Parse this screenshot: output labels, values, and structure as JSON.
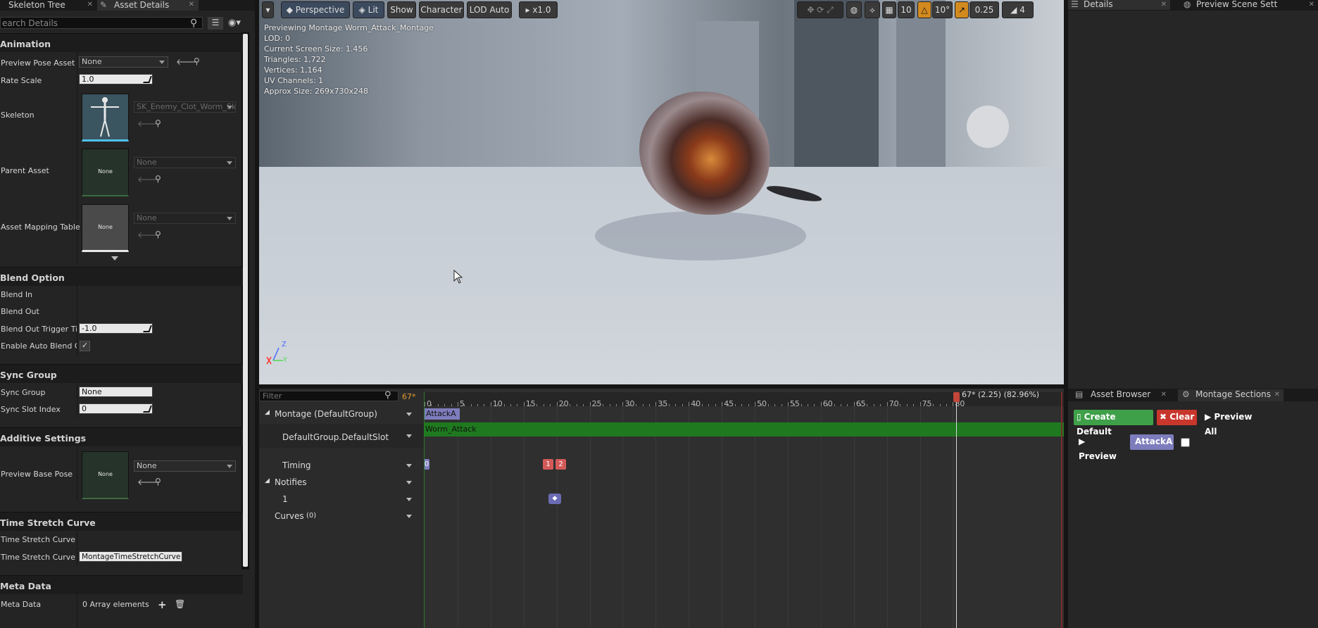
{
  "left_panel": {
    "tabs": [
      {
        "label": "Skeleton Tree"
      },
      {
        "label": "Asset Details"
      }
    ],
    "search_placeholder": "earch Details",
    "animation": {
      "title": "Animation",
      "preview_pose_label": "Preview Pose Asset",
      "preview_pose_value": "None",
      "rate_scale_label": "Rate Scale",
      "rate_scale_value": "1.0",
      "skeleton_label": "Skeleton",
      "skeleton_value": "SK_Enemy_Clot_Worm_Sk",
      "parent_asset_label": "Parent Asset",
      "parent_asset_value": "None",
      "parent_thumb_text": "None",
      "mapping_label": "Asset Mapping Table",
      "mapping_value": "None",
      "mapping_thumb_text": "None"
    },
    "blend": {
      "title": "Blend Option",
      "blend_in": "Blend In",
      "blend_out": "Blend Out",
      "trigger_label": "Blend Out Trigger Tim",
      "trigger_value": "-1.0",
      "auto_label": "Enable Auto Blend Ou"
    },
    "sync": {
      "title": "Sync Group",
      "group_label": "Sync Group",
      "group_value": "None",
      "slot_label": "Sync Slot Index",
      "slot_value": "0"
    },
    "additive": {
      "title": "Additive Settings",
      "base_label": "Preview Base Pose",
      "base_value": "None",
      "base_thumb_text": "None"
    },
    "stretch": {
      "title": "Time Stretch Curve",
      "curve_label": "Time Stretch Curve",
      "curve_name_label": "Time Stretch Curve N",
      "curve_name_value": "MontageTimeStretchCurve"
    },
    "meta": {
      "title": "Meta Data",
      "label": "Meta Data",
      "value": "0 Array elements"
    }
  },
  "viewport": {
    "buttons": {
      "perspective": "Perspective",
      "lit": "Lit",
      "show": "Show",
      "character": "Character",
      "lod": "LOD Auto",
      "speed": "x1.0",
      "grid_snap": "10",
      "rot_snap": "10°",
      "scale_snap": "0.25",
      "cam_speed": "4"
    },
    "stats": [
      "Previewing Montage Worm_Attack_Montage",
      "LOD: 0",
      "Current Screen Size: 1.456",
      "Triangles: 1,722",
      "Vertices: 1,164",
      "UV Channels: 1",
      "Approx Size: 269x730x248"
    ],
    "axis": {
      "z": "Z",
      "y": "Y"
    }
  },
  "timeline": {
    "filter_placeholder": "Filter",
    "frame": "67*",
    "playhead_label": "67* (2.25) (82.96%)",
    "rows": {
      "montage": "Montage (DefaultGroup)",
      "slot": "DefaultGroup.DefaultSlot",
      "timing": "Timing",
      "notifies": "Notifies",
      "notify_track": "1",
      "curves": "Curves",
      "curves_count": "(0)"
    },
    "ticks": [
      "0",
      "5",
      "10",
      "15",
      "20",
      "25",
      "30",
      "35",
      "40",
      "45",
      "50",
      "55",
      "60",
      "65",
      "70",
      "75",
      "80"
    ],
    "playhead_frame": 67,
    "section_name": "AttackA",
    "slot_anim": "Worm_Attack",
    "timing_marks": [
      "0",
      "1",
      "2"
    ]
  },
  "right_panel": {
    "tabs_top": [
      {
        "label": "Details"
      },
      {
        "label": "Preview Scene Sett"
      }
    ],
    "tabs_bottom": [
      {
        "label": "Asset Browser"
      },
      {
        "label": "Montage Sections"
      }
    ],
    "create_default": "Create Default",
    "clear": "Clear",
    "preview_all": "Preview All",
    "preview": "Preview",
    "section": "AttackA"
  }
}
